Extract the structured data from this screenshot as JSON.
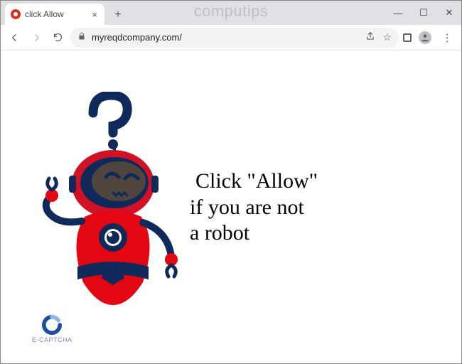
{
  "watermark": "computips",
  "tab": {
    "title": "click Allow"
  },
  "toolbar": {
    "url": "myreqdcompany.com/"
  },
  "page": {
    "line1": "Click \"Allow\"",
    "line2": "if you are not",
    "line3": "a robot",
    "captcha_label": "E-CAPTCHA"
  }
}
